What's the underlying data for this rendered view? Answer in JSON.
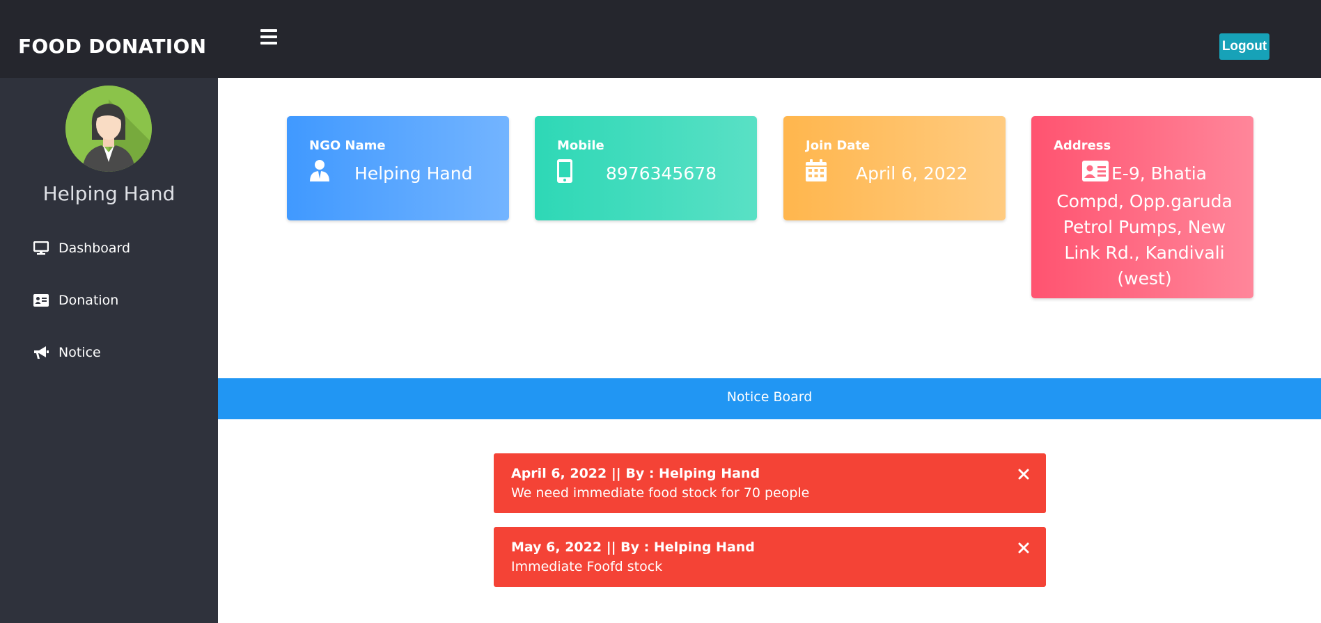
{
  "header": {
    "brand": "FOOD DONATION",
    "logout_label": "Logout"
  },
  "sidebar": {
    "profile_name": "Helping Hand",
    "items": [
      {
        "label": "Dashboard",
        "icon": "desktop-icon"
      },
      {
        "label": "Donation",
        "icon": "id-card-icon"
      },
      {
        "label": "Notice",
        "icon": "bullhorn-icon"
      }
    ]
  },
  "cards": {
    "ngo": {
      "label": "NGO Name",
      "value": "Helping Hand",
      "icon": "user-icon",
      "color_from": "#4099ff",
      "color_to": "#73b4ff"
    },
    "mobile": {
      "label": "Mobile",
      "value": "8976345678",
      "icon": "mobile-phone-icon",
      "color_from": "#2ed8b6",
      "color_to": "#59e0c5"
    },
    "join_date": {
      "label": "Join Date",
      "value": "April 6, 2022",
      "icon": "calendar-icon",
      "color_from": "#ffb64d",
      "color_to": "#ffcb80"
    },
    "address": {
      "label": "Address",
      "value": "E-9, Bhatia Compd, Opp.garuda Petrol Pumps, New Link Rd., Kandivali (west)",
      "icon": "address-card-icon",
      "color_from": "#ff5370",
      "color_to": "#ff869a"
    }
  },
  "notice_board": {
    "title": "Notice Board",
    "notices": [
      {
        "header": "April 6, 2022 || By : Helping Hand",
        "message": "We need immediate food stock for 70 people"
      },
      {
        "header": "May 6, 2022 || By : Helping Hand",
        "message": "Immediate Foofd stock"
      }
    ]
  },
  "colors": {
    "topbar": "#25262d",
    "sidebar": "#2f323c",
    "logout": "#17a2b8",
    "notice_bar": "#2196f3",
    "alert": "#f44336"
  }
}
